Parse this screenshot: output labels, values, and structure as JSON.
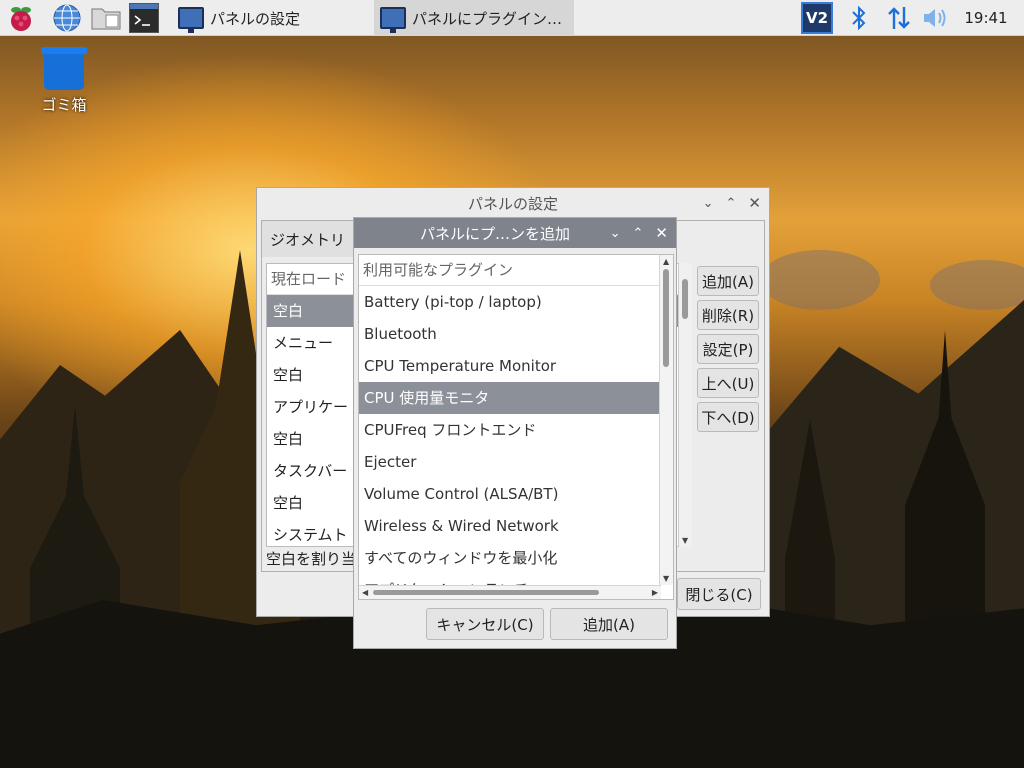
{
  "taskbar": {
    "tasks": [
      {
        "label": "パネルの設定",
        "active": false
      },
      {
        "label": "パネルにプラグイン…",
        "active": true
      }
    ],
    "clock": "19:41",
    "launcher_icons": [
      "raspberry-menu-icon",
      "web-browser-icon",
      "file-manager-icon",
      "terminal-icon"
    ],
    "tray_icons": [
      "vnc-icon",
      "bluetooth-icon",
      "network-icon",
      "volume-icon"
    ]
  },
  "desktop": {
    "trash_label": "ゴミ箱"
  },
  "settings_window": {
    "title": "パネルの設定",
    "tab_label": "ジオメトリ",
    "list_header": "現在ロード",
    "items": [
      "空白",
      "メニュー",
      "空白",
      "アプリケー",
      "空白",
      "タスクバー",
      "空白",
      "システムト"
    ],
    "selected_index": 0,
    "description": "空白を割り当",
    "buttons": {
      "add": "追加(A)",
      "remove": "削除(R)",
      "prefs": "設定(P)",
      "up": "上へ(U)",
      "down": "下へ(D)",
      "close": "閉じる(C)"
    }
  },
  "add_window": {
    "title": "パネルにプ…ンを追加",
    "list_header": "利用可能なプラグイン",
    "items": [
      "Battery (pi-top / laptop)",
      "Bluetooth",
      "CPU Temperature Monitor",
      "CPU 使用量モニタ",
      "CPUFreq フロントエンド",
      "Ejecter",
      "Volume Control (ALSA/BT)",
      "Wireless & Wired Network",
      "すべてのウィンドウを最小化",
      "アプリケーションランチャ"
    ],
    "selected_index": 3,
    "cancel_label": "キャンセル(C)",
    "add_label": "追加(A)"
  },
  "colors": {
    "selection": "#8c9099",
    "titlebar_active": "#7f848c",
    "taskbar_bg": "#ededed"
  }
}
